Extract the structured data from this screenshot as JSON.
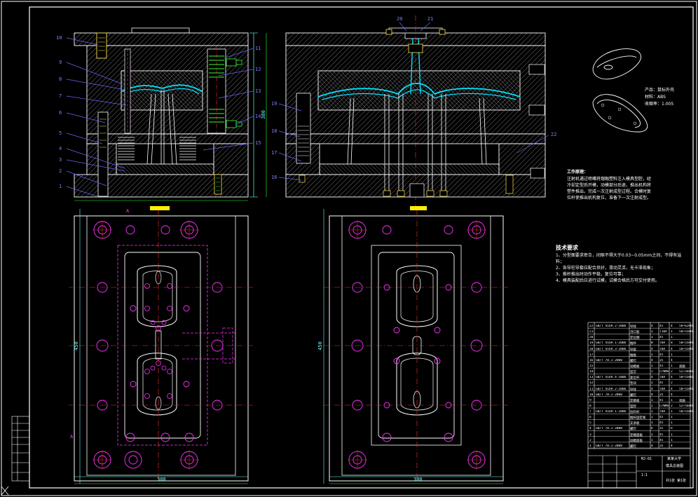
{
  "part_info": {
    "product_label": "产品：鼠标外壳",
    "material_label": "材料：ABS",
    "shrink_label": "收缩率：1.005"
  },
  "notes": {
    "principle_heading": "工作原理：",
    "principle_text": "注射机通过喷嘴将熔融塑料注入模具型腔，经冷却定型后开模，动模部分后退，推出机构将塑件推出，完成一次注射成型过程。合模时复位杆使推出机构复位，准备下一次注射成型。",
    "tech_heading": "技术要求",
    "tech_items": [
      "1、分型面要求密合，间隙不得大于0.03~0.05mm之间，不得有溢料；",
      "2、各导柱导套应配合良好，滑动灵活，无卡滞现象；",
      "3、推杆推出时动作平稳，复位可靠；",
      "4、模具装配后应进行试模，试模合格后方可交付使用。"
    ]
  },
  "callouts": {
    "left": [
      "10",
      "9",
      "8",
      "7",
      "6",
      "5",
      "4",
      "3",
      "2",
      "1"
    ],
    "right": [
      "11",
      "12",
      "13",
      "14",
      "15"
    ],
    "top": [
      "20",
      "21"
    ],
    "section2": [
      "19",
      "18",
      "17",
      "16",
      "22"
    ]
  },
  "dims": {
    "left_height": "380",
    "plan_height": "450",
    "plan_height_right": "450",
    "plan_width_left": "300",
    "plan_width_right": "300",
    "section_a": "A",
    "section_a2": "A"
  },
  "bom_rows": [
    [
      "22",
      "GB/T 4169.2-2006",
      "导柱",
      "4",
      "45",
      "4",
      "58~62HRC"
    ],
    [
      "21",
      "",
      "浇口套",
      "1",
      "T10A",
      "1",
      "50~55HRC"
    ],
    [
      "20",
      "",
      "定位圈",
      "1",
      "45",
      "1",
      ""
    ],
    [
      "19",
      "GB/T 4169.1-2006",
      "推杆",
      "8",
      "T8A",
      "8",
      "50~55HRC"
    ],
    [
      "18",
      "GB/T 4169.3-2006",
      "导套",
      "4",
      "T8A",
      "4",
      "50~55HRC"
    ],
    [
      "17",
      "",
      "推板",
      "1",
      "45",
      "1",
      ""
    ],
    [
      "16",
      "GB/T 70.1-2000",
      "螺钉",
      "4",
      "35",
      "4",
      ""
    ],
    [
      "15",
      "",
      "动模板",
      "1",
      "45",
      "1",
      "调质"
    ],
    [
      "14",
      "",
      "型芯",
      "2",
      "CrWMn",
      "2",
      "52~56HRC"
    ],
    [
      "13",
      "GB/T 4169.4-2006",
      "复位杆",
      "4",
      "T8A",
      "4",
      "50~55HRC"
    ],
    [
      "12",
      "",
      "垫块",
      "2",
      "45",
      "2",
      ""
    ],
    [
      "11",
      "GB/T 4169.2-2006",
      "导柱",
      "4",
      "T8A",
      "4",
      "50~55HRC"
    ],
    [
      "10",
      "GB/T 70.1-2000",
      "螺钉",
      "4",
      "35",
      "4",
      ""
    ],
    [
      "9",
      "",
      "定模板",
      "1",
      "45",
      "1",
      "调质"
    ],
    [
      "8",
      "",
      "型腔",
      "2",
      "CrWMn",
      "2",
      "52~56HRC"
    ],
    [
      "7",
      "GB/T 4169.1-2006",
      "拉料杆",
      "1",
      "T8A",
      "1",
      "50~55HRC"
    ],
    [
      "6",
      "",
      "推杆固定板",
      "1",
      "45",
      "1",
      ""
    ],
    [
      "5",
      "",
      "支承板",
      "1",
      "45",
      "1",
      ""
    ],
    [
      "4",
      "GB/T 70.1-2000",
      "螺钉",
      "6",
      "35",
      "6",
      ""
    ],
    [
      "3",
      "",
      "定模座板",
      "1",
      "45",
      "1",
      ""
    ],
    [
      "2",
      "",
      "动模座板",
      "1",
      "45",
      "1",
      ""
    ],
    [
      "1",
      "GB/T 70.1-2000",
      "螺钉",
      "4",
      "35",
      "4",
      ""
    ]
  ],
  "title_block": {
    "drawing_name": "模具总装图",
    "school": "某某大学",
    "scale": "1:1",
    "sheet": "共1张 第1张",
    "code": "MJ-01"
  },
  "colors": {
    "outline": "#ffffff",
    "plate_line": "#ffffff",
    "center_line": "#ff2d2d",
    "hidden_line": "#ff33ff",
    "dim_line": "#6fffff",
    "plastic": "#00e5ff",
    "callout": "#8080ff",
    "leader": "#6666ff",
    "bolt": "#ffe34d",
    "highlight": "#ffee00",
    "green": "#33ff33",
    "bg": "#000000"
  }
}
